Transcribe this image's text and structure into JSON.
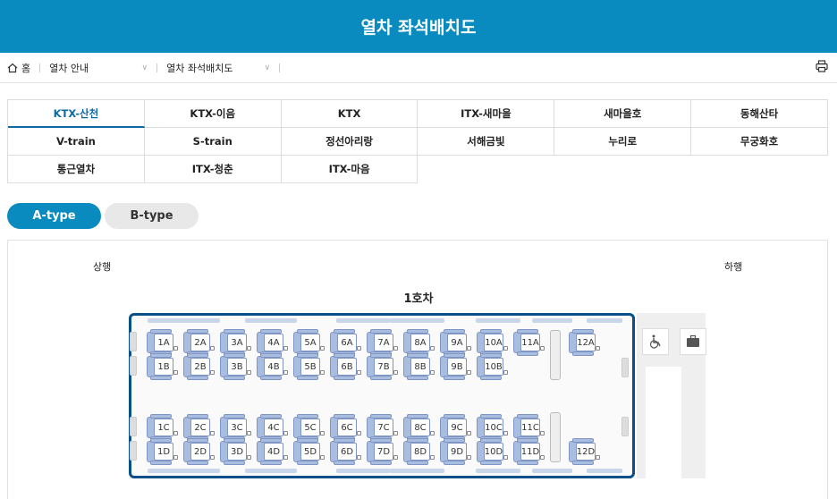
{
  "header": {
    "title": "열차 좌석배치도"
  },
  "breadcrumb": {
    "home": "홈",
    "level1": "열차 안내",
    "level2": "열차 좌석배치도"
  },
  "tabs": [
    [
      "KTX-산천",
      "KTX-이음",
      "KTX",
      "ITX-새마을",
      "새마을호",
      "동해산타"
    ],
    [
      "V-train",
      "S-train",
      "정선아리랑",
      "서해금빛",
      "누리로",
      "무궁화호"
    ],
    [
      "통근열차",
      "ITX-청춘",
      "ITX-마음"
    ]
  ],
  "active_tab": "KTX-산천",
  "types": {
    "a": "A-type",
    "b": "B-type",
    "active": "A-type"
  },
  "directions": {
    "up": "상행",
    "down": "하행"
  },
  "car": {
    "title": "1호차",
    "rows": {
      "A": [
        "1A",
        "2A",
        "3A",
        "4A",
        "5A",
        "6A",
        "7A",
        "8A",
        "9A",
        "10A",
        "11A",
        "12A"
      ],
      "B": [
        "1B",
        "2B",
        "3B",
        "4B",
        "5B",
        "6B",
        "7B",
        "8B",
        "9B",
        "10B"
      ],
      "C": [
        "1C",
        "2C",
        "3C",
        "4C",
        "5C",
        "6C",
        "7C",
        "8C",
        "9C",
        "10C",
        "11C"
      ],
      "D": [
        "1D",
        "2D",
        "3D",
        "4D",
        "5D",
        "6D",
        "7D",
        "8D",
        "9D",
        "10D",
        "11D",
        "12D"
      ]
    },
    "facilities": [
      "wheelchair-icon",
      "luggage-icon"
    ]
  },
  "colors": {
    "header": "#0a8bbf",
    "accent": "#0a6aa6",
    "car_border": "#0b4f8a",
    "seat": "#a9bde0"
  }
}
